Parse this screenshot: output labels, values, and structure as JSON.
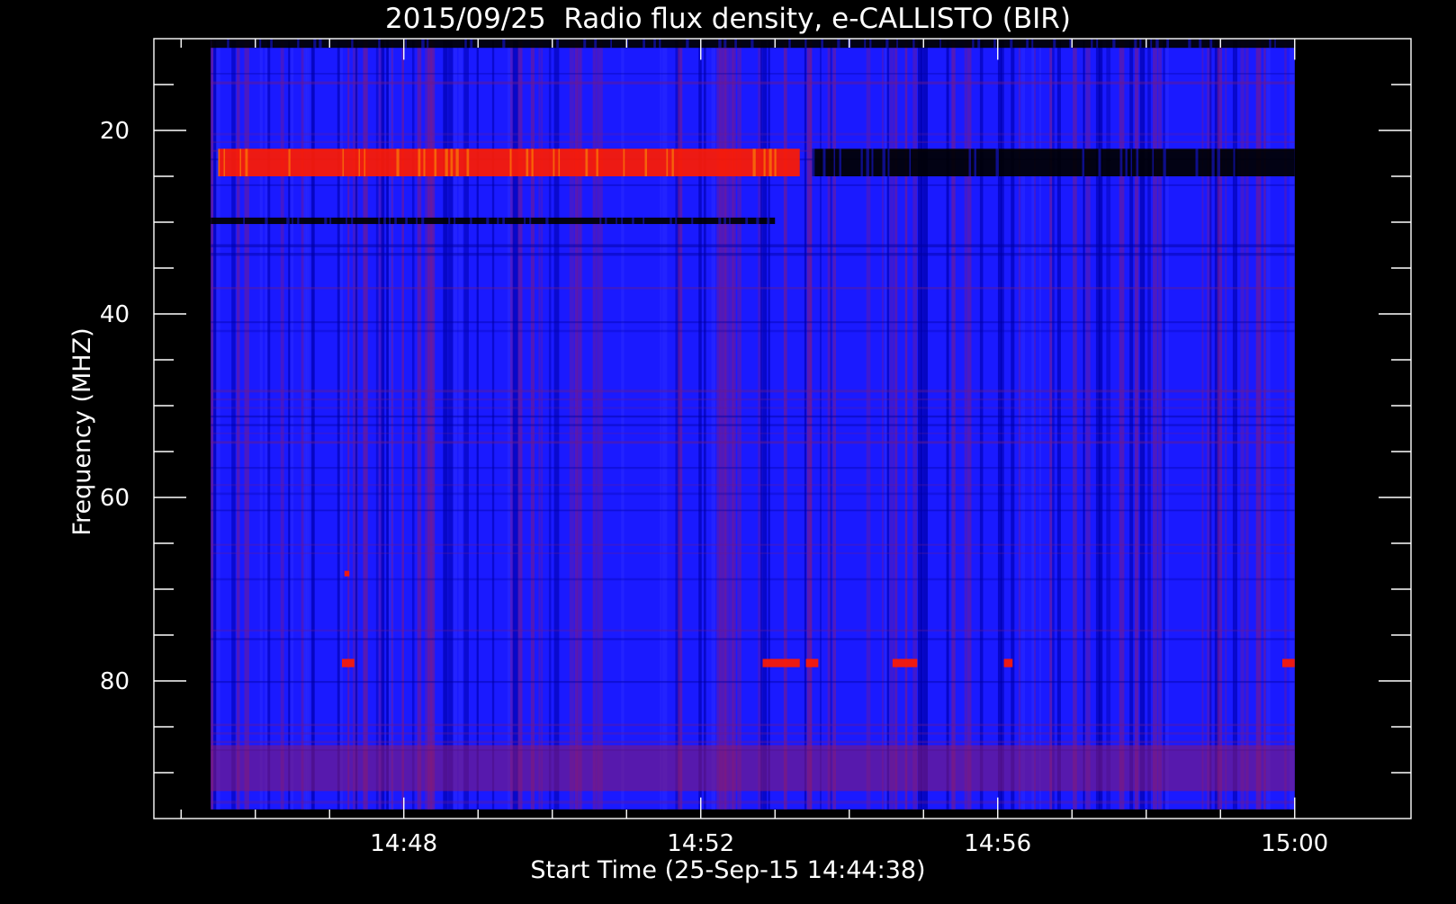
{
  "chart_data": {
    "type": "heatmap",
    "title": "2015/09/25  Radio flux density, e-CALLISTO (BIR)",
    "xlabel": "Start Time (25-Sep-15 14:44:38)",
    "ylabel": "Frequency (MHZ)",
    "x_tick_labels": [
      "14:48",
      "14:52",
      "14:56",
      "15:00"
    ],
    "x_ticks": [
      "14:48",
      "14:52",
      "14:56",
      "15:00"
    ],
    "y_tick_labels": [
      "20",
      "40",
      "60",
      "80"
    ],
    "y_ticks": [
      20,
      40,
      60,
      80
    ],
    "xlim": [
      "14:44:38",
      "15:01:34"
    ],
    "ylim": [
      95,
      10
    ],
    "data_xlim": [
      "14:45:24",
      "15:00:00"
    ],
    "data_ylim": [
      10,
      94
    ],
    "y_inverted": true,
    "grid": false,
    "colormap": {
      "low": "#000000",
      "mid": "#1a1aff",
      "high": "#ff1a00"
    },
    "features": [
      {
        "type": "band",
        "freq_range": [
          22,
          25
        ],
        "time_range": [
          "14:45:30",
          "14:53:20"
        ],
        "intensity": "high"
      },
      {
        "type": "band",
        "freq_range": [
          22,
          25
        ],
        "time_range": [
          "14:53:30",
          "15:00:00"
        ],
        "intensity": "low"
      },
      {
        "type": "band",
        "freq_range": [
          10,
          11
        ],
        "time_range": [
          "14:45:24",
          "15:00:00"
        ],
        "intensity": "low"
      },
      {
        "type": "band",
        "freq_range": [
          29.5,
          30.2
        ],
        "time_range": [
          "14:45:24",
          "14:53:00"
        ],
        "intensity": "low"
      },
      {
        "type": "band",
        "freq_range": [
          87,
          92
        ],
        "time_range": [
          "14:45:24",
          "15:00:00"
        ],
        "intensity": "mixed"
      },
      {
        "type": "spot",
        "freq_range": [
          77.6,
          78.5
        ],
        "time_range": [
          "14:47:10",
          "14:47:20"
        ],
        "intensity": "high"
      },
      {
        "type": "spot",
        "freq_range": [
          77.6,
          78.5
        ],
        "time_range": [
          "14:52:50",
          "14:53:20"
        ],
        "intensity": "high"
      },
      {
        "type": "spot",
        "freq_range": [
          77.6,
          78.5
        ],
        "time_range": [
          "14:53:25",
          "14:53:35"
        ],
        "intensity": "high"
      },
      {
        "type": "spot",
        "freq_range": [
          77.6,
          78.5
        ],
        "time_range": [
          "14:54:35",
          "14:54:55"
        ],
        "intensity": "high"
      },
      {
        "type": "spot",
        "freq_range": [
          77.6,
          78.5
        ],
        "time_range": [
          "14:56:05",
          "14:56:12"
        ],
        "intensity": "high"
      },
      {
        "type": "spot",
        "freq_range": [
          77.6,
          78.5
        ],
        "time_range": [
          "14:59:50",
          "15:00:00"
        ],
        "intensity": "high"
      },
      {
        "type": "spot",
        "freq_range": [
          68,
          68.6
        ],
        "time_range": [
          "14:47:12",
          "14:47:16"
        ],
        "intensity": "high"
      }
    ]
  }
}
